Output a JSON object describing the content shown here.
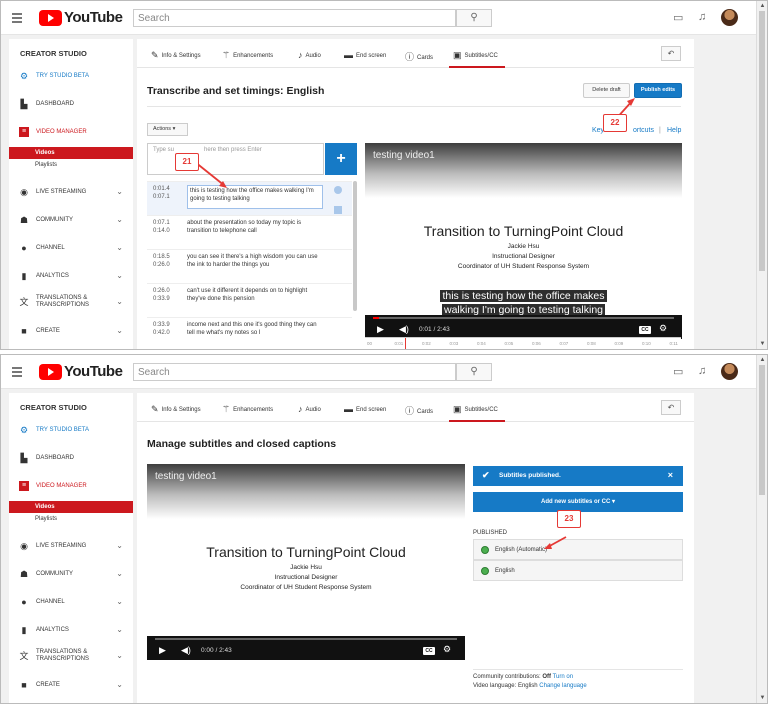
{
  "header": {
    "logo_text": "YouTube",
    "search_placeholder": "Search",
    "search_icon": "search-icon",
    "icons": [
      "video-camera-icon",
      "bell-icon",
      "avatar"
    ]
  },
  "sidebar": {
    "title": "CREATOR STUDIO",
    "try_beta": "TRY STUDIO BETA",
    "dashboard": "DASHBOARD",
    "video_manager": "VIDEO MANAGER",
    "videos": "Videos",
    "playlists": "Playlists",
    "live_streaming": "LIVE STREAMING",
    "community": "COMMUNITY",
    "channel": "CHANNEL",
    "analytics": "ANALYTICS",
    "translations_1": "TRANSLATIONS &",
    "translations_2": "TRANSCRIPTIONS",
    "create": "CREATE"
  },
  "tabs": [
    "Info & Settings",
    "Enhancements",
    "Audio",
    "End screen",
    "Cards",
    "Subtitles/CC"
  ],
  "back_button": "↶",
  "screen1": {
    "heading": "Transcribe and set timings: English",
    "delete_draft": "Delete draft",
    "publish_edits": "Publish edits",
    "actions": "Actions ▾",
    "links_left": "Key",
    "links_mid": "ortcuts",
    "links_sep": "|",
    "links_help": "Help",
    "input_placeholder": "Type su",
    "input_placeholder_rest": "here then press Enter",
    "add_button": "+",
    "captions": [
      {
        "start": "0:01.4",
        "end": "0:07.1",
        "text": "this is testing how the office makes walking I'm going to testing talking"
      },
      {
        "start": "0:07.1",
        "end": "0:14.0",
        "text": "about the presentation so today my topic is transition to telephone call"
      },
      {
        "start": "0:18.5",
        "end": "0:26.0",
        "text": "you can see it there's a high wisdom you can use the ink to harder the things you"
      },
      {
        "start": "0:26.0",
        "end": "0:33.9",
        "text": "can't use it different it depends on to highlight they've done this pension"
      },
      {
        "start": "0:33.9",
        "end": "0:42.0",
        "text": "income next and this one it's good thing they can tell me what's my notes so I"
      }
    ],
    "video": {
      "title": "testing video1",
      "slide_title": "Transition to TurningPoint Cloud",
      "slide_line1": "Jackie Hsu",
      "slide_line2": "Instructional Designer",
      "slide_line3": "Coordinator of UH Student Response System",
      "subtitle_line1": "this is testing how the office makes",
      "subtitle_line2": "walking I'm going to testing talking",
      "time": "0:01 / 2:43",
      "progress": 0.01
    },
    "timeline_ticks": [
      "00",
      "0:01",
      "0:02",
      "0:03",
      "0:04",
      "0:05",
      "0:06",
      "0:07",
      "0:08",
      "0:09",
      "0:10",
      "0:11"
    ],
    "callout_21": "21",
    "callout_22": "22"
  },
  "screen2": {
    "heading": "Manage subtitles and closed captions",
    "video": {
      "title": "testing video1",
      "slide_title": "Transition to TurningPoint Cloud",
      "slide_line1": "Jackie Hsu",
      "slide_line2": "Instructional Designer",
      "slide_line3": "Coordinator of UH Student Response System",
      "time": "0:00 / 2:43"
    },
    "published_notice": "Subtitles published.",
    "close": "×",
    "add_new": "Add new subtitles or CC ▾",
    "published_label": "PUBLISHED",
    "languages": [
      "English (Automatic)",
      "English"
    ],
    "community_contrib_label": "Community contributions:",
    "community_contrib_value": "Off",
    "community_contrib_link": "Turn on",
    "video_lang_label": "Video language:",
    "video_lang_value": "English",
    "video_lang_link": "Change language",
    "callout_23": "23"
  },
  "colors": {
    "red": "#cc181e",
    "blue": "#167ac6",
    "callout": "#e53935"
  }
}
